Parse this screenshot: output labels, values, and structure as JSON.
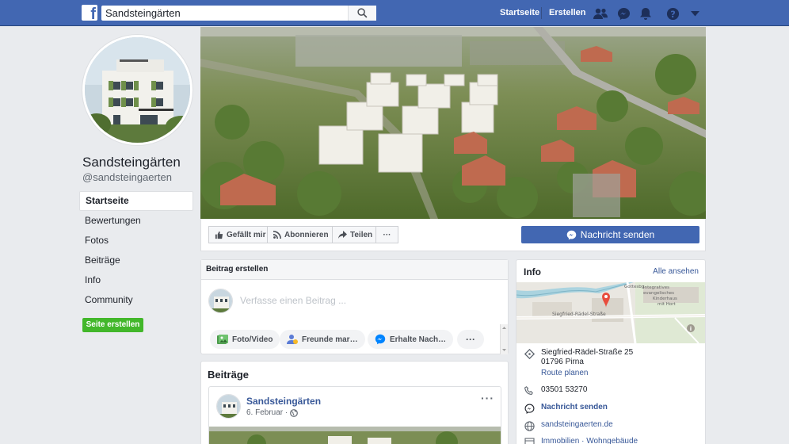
{
  "topbar": {
    "search_value": "Sandsteingärten",
    "nav_home": "Startseite",
    "nav_create": "Erstellen",
    "brand_color": "#4267b2"
  },
  "page": {
    "name": "Sandsteingärten",
    "handle": "@sandsteingaerten"
  },
  "left_nav": [
    {
      "label": "Startseite",
      "active": true
    },
    {
      "label": "Bewertungen"
    },
    {
      "label": "Fotos"
    },
    {
      "label": "Beiträge"
    },
    {
      "label": "Info"
    },
    {
      "label": "Community"
    }
  ],
  "create_page_label": "Seite erstellen",
  "actions": {
    "like": "Gefällt mir",
    "follow": "Abonnieren",
    "share": "Teilen",
    "more": "···",
    "message": "Nachricht senden"
  },
  "composer": {
    "title": "Beitrag erstellen",
    "placeholder": "Verfasse einen Beitrag ...",
    "photo_video": "Foto/Video",
    "tag_friends": "Freunde mar…",
    "get_messages": "Erhalte Nach…",
    "more": "···"
  },
  "posts": {
    "title": "Beiträge",
    "author": "Sandsteingärten",
    "date": "6. Februar ·",
    "more": "···"
  },
  "info": {
    "title": "Info",
    "see_all": "Alle ansehen",
    "address_line1": "Siegfried-Rädel-Straße 25",
    "address_line2": "01796 Pirna",
    "route": "Route planen",
    "phone": "03501 53270",
    "message": "Nachricht senden",
    "website": "sandsteingaerten.de",
    "category": "Immobilien · Wohngebäude",
    "map_labels": {
      "street": "Siegfried-Rädel-Straße",
      "poi_line1": "Integratives",
      "poi_line2": "evangelisches",
      "poi_line3": "Kinderhaus",
      "poi_line4": "mit Hort",
      "top": "Gottesbg."
    }
  }
}
